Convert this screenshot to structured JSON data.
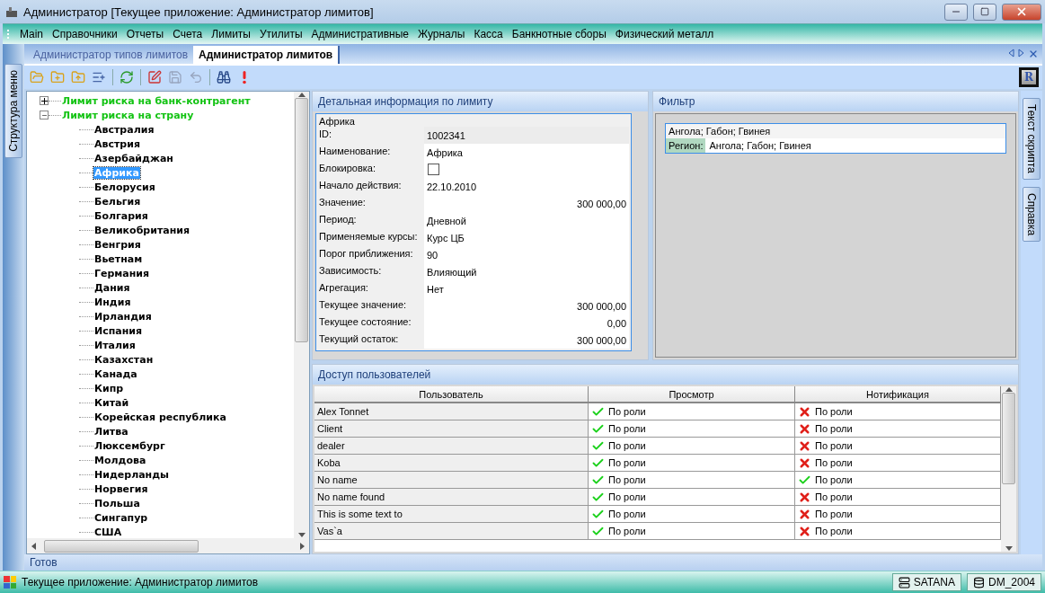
{
  "window": {
    "title": "Администратор [Текущее приложение: Администратор лимитов]"
  },
  "menu": [
    "Main",
    "Справочники",
    "Отчеты",
    "Счета",
    "Лимиты",
    "Утилиты",
    "Административные",
    "Журналы",
    "Касса",
    "Банкнотные сборы",
    "Физический металл"
  ],
  "left_tabs": [
    {
      "label": "Структура меню"
    }
  ],
  "doc_tabs": [
    {
      "label": "Администратор типов лимитов",
      "selected": false
    },
    {
      "label": "Администратор лимитов",
      "selected": true
    }
  ],
  "toolbar": [
    {
      "kind": "open",
      "disabled": false
    },
    {
      "kind": "new",
      "disabled": false
    },
    {
      "kind": "up",
      "disabled": false
    },
    {
      "kind": "add",
      "disabled": false
    },
    {
      "kind": "sep"
    },
    {
      "kind": "refresh",
      "disabled": false
    },
    {
      "kind": "sep"
    },
    {
      "kind": "edit",
      "disabled": false
    },
    {
      "kind": "save",
      "disabled": true
    },
    {
      "kind": "undo",
      "disabled": true
    },
    {
      "kind": "sep"
    },
    {
      "kind": "find",
      "disabled": false
    },
    {
      "kind": "alert",
      "disabled": false
    }
  ],
  "logo": "R",
  "tree": [
    {
      "label": "Лимит риска на банк-контрагент",
      "expanded": false,
      "selected": false
    },
    {
      "label": "Лимит риска на страну",
      "expanded": true,
      "selected": false,
      "children": [
        {
          "label": "Австралия",
          "selected": false
        },
        {
          "label": "Австрия",
          "selected": false
        },
        {
          "label": "Азербайджан",
          "selected": false
        },
        {
          "label": "Африка",
          "selected": true
        },
        {
          "label": "Белорусия",
          "selected": false
        },
        {
          "label": "Бельгия",
          "selected": false
        },
        {
          "label": "Болгария",
          "selected": false
        },
        {
          "label": "Великобритания",
          "selected": false
        },
        {
          "label": "Венгрия",
          "selected": false
        },
        {
          "label": "Вьетнам",
          "selected": false
        },
        {
          "label": "Германия",
          "selected": false
        },
        {
          "label": "Дания",
          "selected": false
        },
        {
          "label": "Индия",
          "selected": false
        },
        {
          "label": "Ирландия",
          "selected": false
        },
        {
          "label": "Испания",
          "selected": false
        },
        {
          "label": "Италия",
          "selected": false
        },
        {
          "label": "Казахстан",
          "selected": false
        },
        {
          "label": "Канада",
          "selected": false
        },
        {
          "label": "Кипр",
          "selected": false
        },
        {
          "label": "Китай",
          "selected": false
        },
        {
          "label": "Корейская республика",
          "selected": false
        },
        {
          "label": "Литва",
          "selected": false
        },
        {
          "label": "Люксембург",
          "selected": false
        },
        {
          "label": "Молдова",
          "selected": false
        },
        {
          "label": "Нидерланды",
          "selected": false
        },
        {
          "label": "Норвегия",
          "selected": false
        },
        {
          "label": "Польша",
          "selected": false
        },
        {
          "label": "Сингапур",
          "selected": false
        },
        {
          "label": "США",
          "selected": false
        }
      ]
    }
  ],
  "detail": {
    "title": "Детальная информация по лимиту",
    "heading": "Африка",
    "fields": [
      {
        "label": "ID:",
        "kind": "text",
        "value": "1002341",
        "highlighted": true
      },
      {
        "label": "Наименование:",
        "kind": "text",
        "value": "Африка",
        "highlighted": false
      },
      {
        "label": "Блокировка:",
        "kind": "checkbox",
        "checked": false
      },
      {
        "label": "Начало действия:",
        "kind": "text",
        "value": "22.10.2010",
        "highlighted": false
      },
      {
        "label": "Значение:",
        "kind": "number",
        "value": "300 000,00"
      },
      {
        "label": "Период:",
        "kind": "text",
        "value": "Дневной",
        "highlighted": false
      },
      {
        "label": "Применяемые курсы:",
        "kind": "text",
        "value": "Курс ЦБ",
        "highlighted": false
      },
      {
        "label": "Порог приближения:",
        "kind": "text",
        "value": "90",
        "highlighted": false
      },
      {
        "label": "Зависимость:",
        "kind": "text",
        "value": "Влияющий",
        "highlighted": false
      },
      {
        "label": "Агрегация:",
        "kind": "text",
        "value": "Нет",
        "highlighted": false
      },
      {
        "label": "Текущее значение:",
        "kind": "number",
        "value": "300 000,00"
      },
      {
        "label": "Текущее состояние:",
        "kind": "number",
        "value": "0,00"
      },
      {
        "label": "Текущий остаток:",
        "kind": "number",
        "value": "300 000,00"
      }
    ]
  },
  "filter": {
    "title": "Фильтр",
    "summary": "Ангола; Габон; Гвинея",
    "label": "Регион:",
    "value": "Ангола; Габон; Гвинея"
  },
  "users": {
    "title": "Доступ пользователей",
    "columns": [
      "Пользователь",
      "Просмотр",
      "Нотификация"
    ],
    "rows": [
      {
        "user": "Alex Tonnet",
        "view": {
          "allowed": true,
          "text": "По роли"
        },
        "notify": {
          "allowed": false,
          "text": "По роли"
        }
      },
      {
        "user": "Client",
        "view": {
          "allowed": true,
          "text": "По роли"
        },
        "notify": {
          "allowed": false,
          "text": "По роли"
        }
      },
      {
        "user": "dealer",
        "view": {
          "allowed": true,
          "text": "По роли"
        },
        "notify": {
          "allowed": false,
          "text": "По роли"
        }
      },
      {
        "user": "Koba",
        "view": {
          "allowed": true,
          "text": "По роли"
        },
        "notify": {
          "allowed": false,
          "text": "По роли"
        }
      },
      {
        "user": "No name",
        "view": {
          "allowed": true,
          "text": "По роли"
        },
        "notify": {
          "allowed": true,
          "text": "По роли"
        }
      },
      {
        "user": "No name found",
        "view": {
          "allowed": true,
          "text": "По роли"
        },
        "notify": {
          "allowed": false,
          "text": "По роли"
        }
      },
      {
        "user": "This is some text to",
        "view": {
          "allowed": true,
          "text": "По роли"
        },
        "notify": {
          "allowed": false,
          "text": "По роли"
        }
      },
      {
        "user": "Vas`a",
        "view": {
          "allowed": true,
          "text": "По роли"
        },
        "notify": {
          "allowed": false,
          "text": "По роли"
        }
      }
    ]
  },
  "right_tabs": [
    {
      "label": "Текст скрипта"
    },
    {
      "label": "Справка"
    }
  ],
  "status": "Готов",
  "status_bar": {
    "text": "Текущее приложение: Администратор лимитов",
    "server": "SATANA",
    "database": "DM_2004"
  }
}
